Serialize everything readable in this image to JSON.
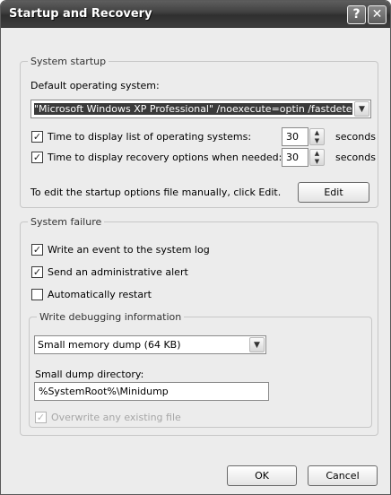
{
  "window": {
    "title": "Startup and Recovery",
    "help_glyph": "?",
    "close_glyph": "✕"
  },
  "system_startup": {
    "legend": "System startup",
    "default_os_label": "Default operating system:",
    "default_os_value": "\"Microsoft Windows XP Professional\" /noexecute=optin /fastdete",
    "time_list_label": "Time to display list of operating systems:",
    "time_list_checked": true,
    "time_list_value": "30",
    "time_list_unit": "seconds",
    "time_recovery_label": "Time to display recovery options when needed:",
    "time_recovery_checked": true,
    "time_recovery_value": "30",
    "time_recovery_unit": "seconds",
    "edit_hint": "To edit the startup options file manually, click Edit.",
    "edit_button": "Edit"
  },
  "system_failure": {
    "legend": "System failure",
    "write_event_label": "Write an event to the system log",
    "write_event_checked": true,
    "send_alert_label": "Send an administrative alert",
    "send_alert_checked": true,
    "auto_restart_label": "Automatically restart",
    "auto_restart_checked": false,
    "debug_group": {
      "legend": "Write debugging information",
      "dump_type_value": "Small memory dump (64 KB)",
      "dump_dir_label": "Small dump directory:",
      "dump_dir_value": "%SystemRoot%\\Minidump",
      "overwrite_label": "Overwrite any existing file",
      "overwrite_checked": true
    }
  },
  "footer": {
    "ok_button": "OK",
    "cancel_button": "Cancel"
  },
  "glyphs": {
    "check": "✓",
    "dropdown_arrow": "▼",
    "spin_up": "▲",
    "spin_down": "▼"
  }
}
